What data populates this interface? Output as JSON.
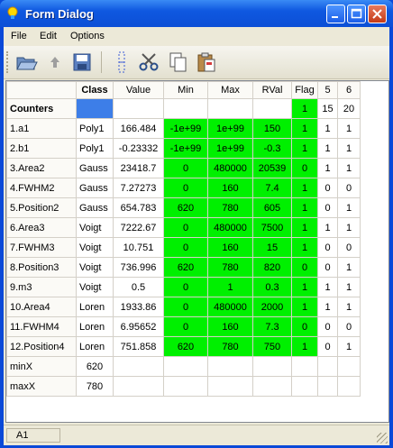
{
  "window": {
    "title": "Form Dialog",
    "icon": "app-bulb-icon"
  },
  "title_buttons": [
    {
      "name": "minimize-button",
      "glyph": "_"
    },
    {
      "name": "maximize-button",
      "glyph": "□"
    },
    {
      "name": "close-button",
      "glyph": "✕"
    }
  ],
  "menu": [
    "File",
    "Edit",
    "Options"
  ],
  "toolbar": [
    "open-folder-icon",
    "up-arrow-icon",
    "save-icon",
    "column-icon",
    "cut-icon",
    "copy-icon",
    "paste-icon"
  ],
  "table": {
    "headers": [
      "",
      "Class",
      "Value",
      "Min",
      "Max",
      "RVal",
      "Flag",
      "5",
      "6"
    ],
    "rows": [
      {
        "label": "Counters",
        "cells": [
          "",
          "",
          "",
          "",
          "",
          "1",
          "15",
          "20"
        ],
        "green": [
          5
        ],
        "selected": [
          0
        ],
        "bold": true
      },
      {
        "label": "1.a1",
        "cells": [
          "Poly1",
          "166.484",
          "-1e+99",
          "1e+99",
          "150",
          "1",
          "1",
          "1"
        ],
        "green": [
          2,
          3,
          4,
          5
        ]
      },
      {
        "label": "2.b1",
        "cells": [
          "Poly1",
          "-0.23332",
          "-1e+99",
          "1e+99",
          "-0.3",
          "1",
          "1",
          "1"
        ],
        "green": [
          2,
          3,
          4,
          5
        ]
      },
      {
        "label": "3.Area2",
        "cells": [
          "Gauss",
          "23418.7",
          "0",
          "480000",
          "20539",
          "0",
          "1",
          "1"
        ],
        "green": [
          2,
          3,
          4,
          5
        ]
      },
      {
        "label": "4.FWHM2",
        "cells": [
          "Gauss",
          "7.27273",
          "0",
          "160",
          "7.4",
          "1",
          "0",
          "0"
        ],
        "green": [
          2,
          3,
          4,
          5
        ]
      },
      {
        "label": "5.Position2",
        "cells": [
          "Gauss",
          "654.783",
          "620",
          "780",
          "605",
          "1",
          "0",
          "1"
        ],
        "green": [
          2,
          3,
          4,
          5
        ]
      },
      {
        "label": "6.Area3",
        "cells": [
          "Voigt",
          "7222.67",
          "0",
          "480000",
          "7500",
          "1",
          "1",
          "1"
        ],
        "green": [
          2,
          3,
          4,
          5
        ]
      },
      {
        "label": "7.FWHM3",
        "cells": [
          "Voigt",
          "10.751",
          "0",
          "160",
          "15",
          "1",
          "0",
          "0"
        ],
        "green": [
          2,
          3,
          4,
          5
        ]
      },
      {
        "label": "8.Position3",
        "cells": [
          "Voigt",
          "736.996",
          "620",
          "780",
          "820",
          "0",
          "0",
          "1"
        ],
        "green": [
          2,
          3,
          4,
          5
        ]
      },
      {
        "label": "9.m3",
        "cells": [
          "Voigt",
          "0.5",
          "0",
          "1",
          "0.3",
          "1",
          "1",
          "1"
        ],
        "green": [
          2,
          3,
          4,
          5
        ]
      },
      {
        "label": "10.Area4",
        "cells": [
          "Loren",
          "1933.86",
          "0",
          "480000",
          "2000",
          "1",
          "1",
          "1"
        ],
        "green": [
          2,
          3,
          4,
          5
        ]
      },
      {
        "label": "11.FWHM4",
        "cells": [
          "Loren",
          "6.95652",
          "0",
          "160",
          "7.3",
          "0",
          "0",
          "0"
        ],
        "green": [
          2,
          3,
          4,
          5
        ]
      },
      {
        "label": "12.Position4",
        "cells": [
          "Loren",
          "751.858",
          "620",
          "780",
          "750",
          "1",
          "0",
          "1"
        ],
        "green": [
          2,
          3,
          4,
          5
        ]
      },
      {
        "label": "minX",
        "cells": [
          "620",
          "",
          "",
          "",
          "",
          "",
          "",
          ""
        ],
        "green": []
      },
      {
        "label": "maxX",
        "cells": [
          "780",
          "",
          "",
          "",
          "",
          "",
          "",
          ""
        ],
        "green": []
      }
    ]
  },
  "status": {
    "cell": "A1"
  }
}
